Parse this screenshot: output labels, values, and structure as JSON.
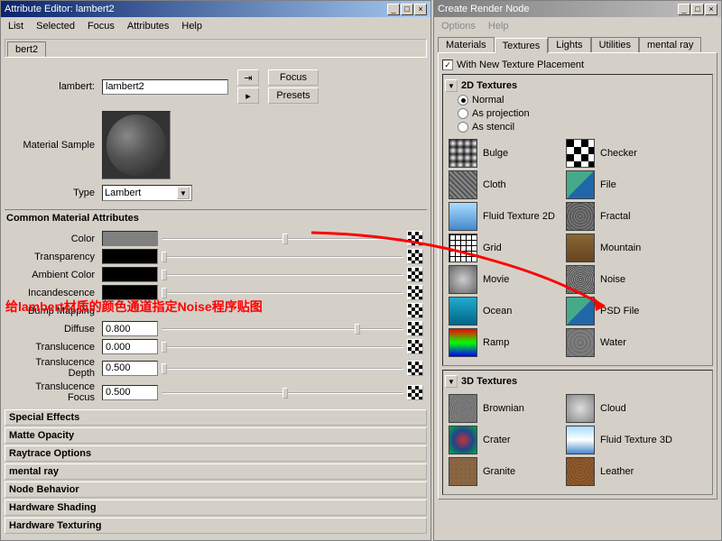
{
  "left": {
    "title": "Attribute Editor: lambert2",
    "menu": [
      "List",
      "Selected",
      "Focus",
      "Attributes",
      "Help"
    ],
    "tab": "bert2",
    "name_label": "lambert:",
    "name_value": "lambert2",
    "focus_btn": "Focus",
    "presets_btn": "Presets",
    "material_sample": "Material Sample",
    "type_label": "Type",
    "type_value": "Lambert",
    "section_common": "Common Material Attributes",
    "attrs": {
      "color": "Color",
      "transparency": "Transparency",
      "ambient": "Ambient Color",
      "incandescence": "Incandescence",
      "bump": "Bump Mapping",
      "diffuse": "Diffuse",
      "diffuse_val": "0.800",
      "translucence": "Translucence",
      "translucence_val": "0.000",
      "transl_depth": "Translucence Depth",
      "transl_depth_val": "0.500",
      "transl_focus": "Translucence Focus",
      "transl_focus_val": "0.500"
    },
    "sections": [
      "Special Effects",
      "Matte Opacity",
      "Raytrace Options",
      "mental ray",
      "Node Behavior",
      "Hardware Shading",
      "Hardware Texturing"
    ]
  },
  "right": {
    "title": "Create Render Node",
    "menu": [
      "Options",
      "Help"
    ],
    "tabs": [
      "Materials",
      "Textures",
      "Lights",
      "Utilities",
      "mental ray"
    ],
    "with_placement": "With New Texture Placement",
    "section_2d": "2D Textures",
    "modes": {
      "normal": "Normal",
      "projection": "As projection",
      "stencil": "As stencil"
    },
    "textures_2d": [
      [
        "Bulge",
        "Checker"
      ],
      [
        "Cloth",
        "File"
      ],
      [
        "Fluid Texture 2D",
        "Fractal"
      ],
      [
        "Grid",
        "Mountain"
      ],
      [
        "Movie",
        "Noise"
      ],
      [
        "Ocean",
        "PSD File"
      ],
      [
        "Ramp",
        "Water"
      ]
    ],
    "section_3d": "3D Textures",
    "textures_3d": [
      [
        "Brownian",
        "Cloud"
      ],
      [
        "Crater",
        "Fluid Texture 3D"
      ],
      [
        "Granite",
        "Leather"
      ]
    ]
  },
  "annotation_text": "给lambert材质的颜色通道指定Noise程序贴图"
}
